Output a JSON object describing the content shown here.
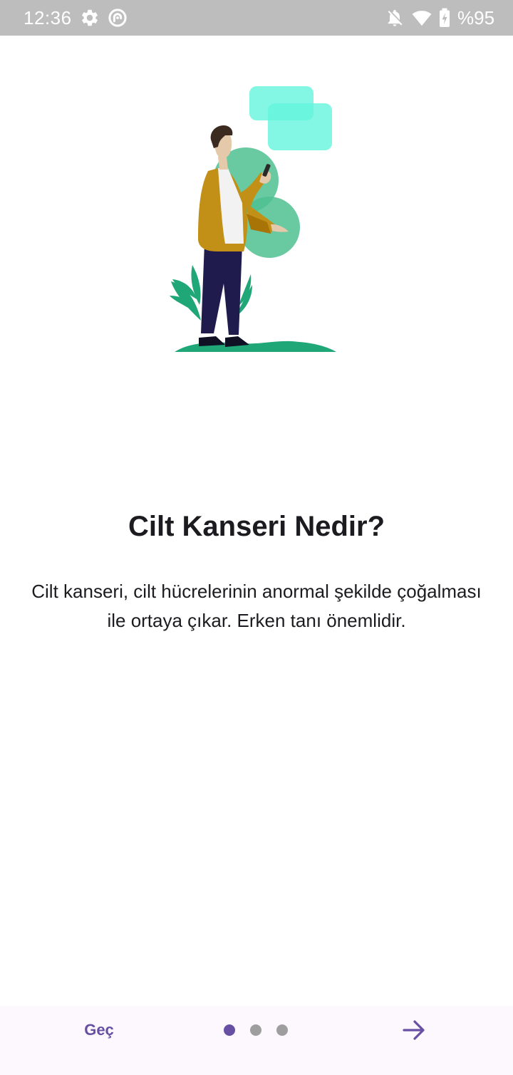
{
  "status_bar": {
    "time": "12:36",
    "battery": "%95",
    "icons": [
      "gear-icon",
      "sync-icon",
      "notifications-off-icon",
      "wifi-icon",
      "battery-charging-icon"
    ]
  },
  "onboarding": {
    "title": "Cilt Kanseri Nedir?",
    "description": "Cilt kanseri, cilt hücrelerinin anormal şekilde çoğalması ile ortaya çıkar. Erken tanı önemlidir.",
    "illustration_icon": "man-with-phone-illustration"
  },
  "navigation": {
    "skip_label": "Geç",
    "page_count": 3,
    "current_page": 1,
    "next_icon": "arrow-right-icon"
  },
  "colors": {
    "status_bar_bg": "#bdbdbd",
    "accent": "#6750a4",
    "dot_inactive": "#9e9e9e",
    "bottom_bar_bg": "#fdf8fd",
    "text": "#1c1b1f"
  }
}
